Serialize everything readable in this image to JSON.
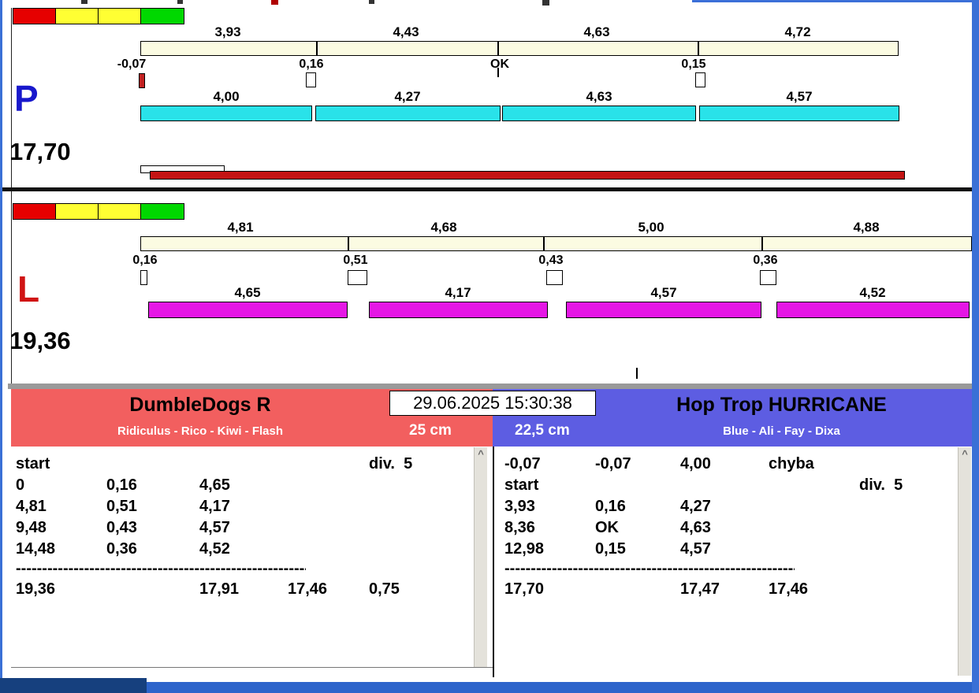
{
  "lanes": {
    "p": {
      "label": "P",
      "total": "17,70",
      "upper_splits": [
        "3,93",
        "4,43",
        "4,63",
        "4,72"
      ],
      "marks": [
        "-0,07",
        "0,16",
        "OK",
        "0,15"
      ],
      "lower_splits": [
        "4,00",
        "4,27",
        "4,63",
        "4,57"
      ]
    },
    "l": {
      "label": "L",
      "total": "19,36",
      "upper_splits": [
        "4,81",
        "4,68",
        "5,00",
        "4,88"
      ],
      "marks": [
        "0,16",
        "0,51",
        "0,43",
        "0,36"
      ],
      "lower_splits": [
        "4,65",
        "4,17",
        "4,57",
        "4,52"
      ]
    }
  },
  "scoreboard": {
    "timestamp": "29.06.2025 15:30:38",
    "separator": "------------------------------------------------------------",
    "left": {
      "team": "DumbleDogs R",
      "lineup": "Ridiculus - Rico - Kiwi - Flash",
      "jump_height": "25 cm",
      "rows": [
        [
          "start",
          "",
          "",
          "",
          "div.  5"
        ],
        [
          "0",
          "0,16",
          "4,65",
          "",
          ""
        ],
        [
          "4,81",
          "0,51",
          "4,17",
          "",
          ""
        ],
        [
          "9,48",
          "0,43",
          "4,57",
          "",
          ""
        ],
        [
          "14,48",
          "0,36",
          "4,52",
          "",
          ""
        ],
        [
          "19,36",
          "",
          "17,91",
          "17,46",
          "0,75"
        ]
      ]
    },
    "right": {
      "team": "Hop Trop HURRICANE",
      "lineup": "Blue - Ali - Fay - Dixa",
      "jump_height": "22,5 cm",
      "penalty_row": [
        "-0,07",
        "-0,07",
        "4,00",
        "chyba",
        ""
      ],
      "rows": [
        [
          "start",
          "",
          "",
          "",
          "div.  5"
        ],
        [
          "3,93",
          "0,16",
          "4,27",
          "",
          ""
        ],
        [
          "8,36",
          "OK",
          "4,63",
          "",
          ""
        ],
        [
          "12,98",
          "0,15",
          "4,57",
          "",
          ""
        ],
        [
          "17,70",
          "",
          "17,47",
          "17,46",
          ""
        ]
      ]
    }
  },
  "icons": {
    "scroll_up": "^"
  },
  "colors": {
    "cyan_bar": "#29e2e9",
    "magenta_bar": "#e517e5",
    "progress_red": "#c41414",
    "left_header": "#f25f5f",
    "right_header": "#5d5de2",
    "lane_p_letter": "#1818cc",
    "lane_l_letter": "#d01414",
    "traffic_red": "#e60000",
    "traffic_yellow": "#ffff33",
    "traffic_green": "#00d800",
    "window_border": "#3a70d6"
  }
}
